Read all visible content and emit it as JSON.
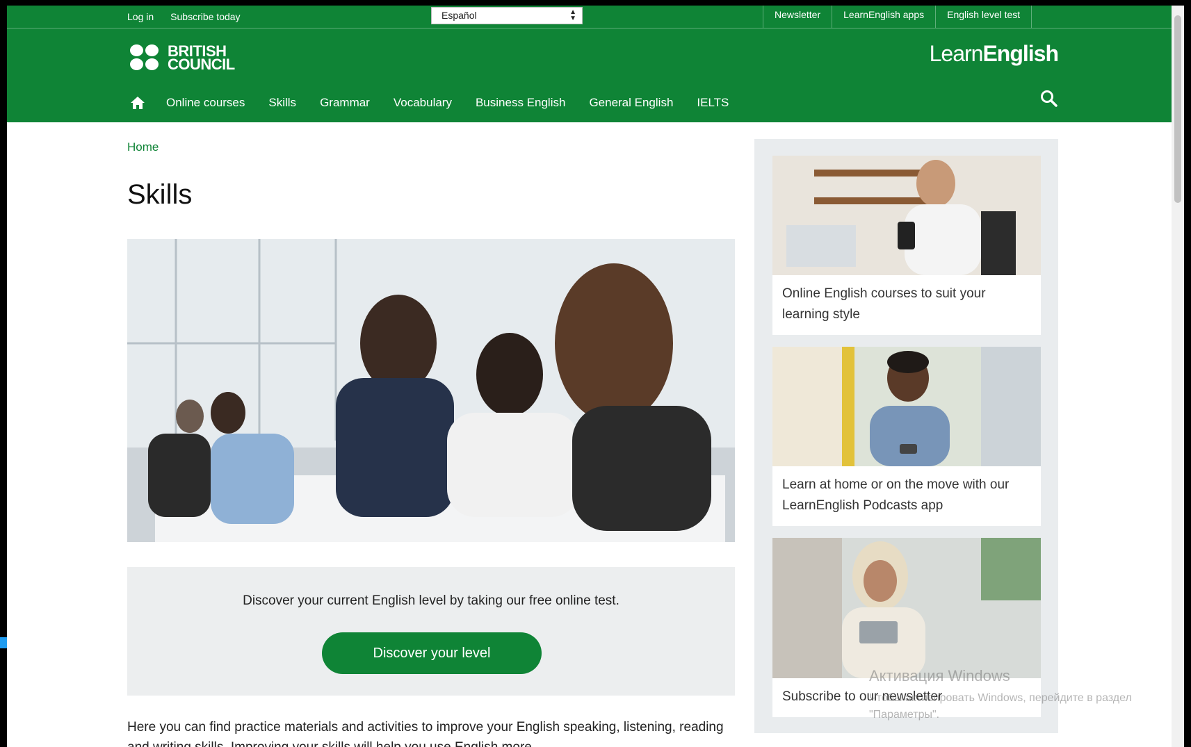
{
  "utility_bar": {
    "login": "Log in",
    "subscribe": "Subscribe today",
    "language": "Español",
    "right_links": [
      "Newsletter",
      "LearnEnglish apps",
      "English level test"
    ]
  },
  "header": {
    "logo_line1": "BRITISH",
    "logo_line2": "COUNCIL",
    "brand_light": "Learn",
    "brand_bold": "English",
    "nav": [
      "Online courses",
      "Skills",
      "Grammar",
      "Vocabulary",
      "Business English",
      "General English",
      "IELTS"
    ]
  },
  "main": {
    "breadcrumb": "Home",
    "title": "Skills",
    "cta_text": "Discover your current English level by taking our free online test.",
    "cta_button": "Discover your level",
    "intro": "Here you can find practice materials and activities to improve your English speaking, listening, reading and writing skills. Improving your skills will help you use English more"
  },
  "sidebar": {
    "cards": [
      {
        "text": "Online English courses to suit your learning style"
      },
      {
        "text": "Learn at home or on the move with our LearnEnglish Podcasts app"
      },
      {
        "text": "Subscribe to our newsletter"
      }
    ]
  },
  "watermark": {
    "line1": "Активация Windows",
    "line2": "Чтобы активировать Windows, перейдите в раздел \"Параметры\"."
  },
  "colors": {
    "brand_green": "#0f8436",
    "panel_grey": "#eceeef"
  }
}
